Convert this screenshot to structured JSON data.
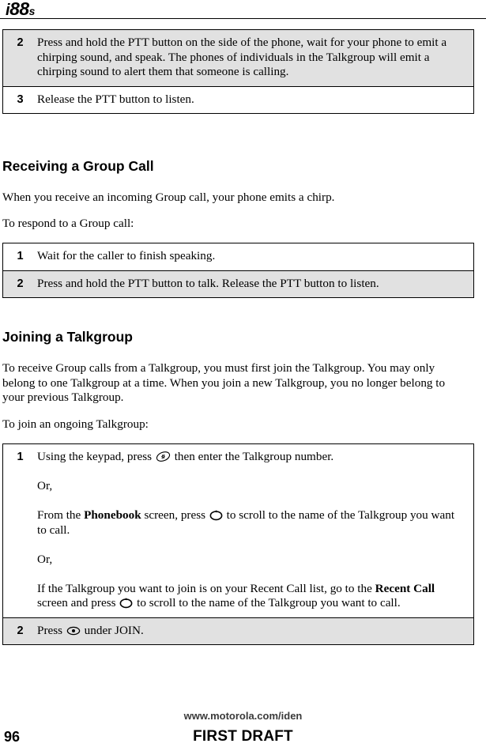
{
  "header": {
    "logo_i": "i",
    "logo_88": "88",
    "logo_s": "s"
  },
  "tables": {
    "making_group_call_continued": {
      "rows": [
        {
          "number": "2",
          "shaded": true,
          "text": "Press and hold the PTT button on the side of the phone, wait for your phone to emit a chirping sound, and speak. The phones of individuals in the Talkgroup will emit a chirping sound to alert them that someone is calling."
        },
        {
          "number": "3",
          "shaded": false,
          "text": "Release the PTT button to listen."
        }
      ]
    },
    "receiving_group_call": {
      "rows": [
        {
          "number": "1",
          "shaded": false,
          "text": "Wait for the caller to finish speaking."
        },
        {
          "number": "2",
          "shaded": true,
          "text": "Press and hold the PTT button to talk. Release the PTT button to listen."
        }
      ]
    },
    "joining_talkgroup": {
      "rows": [
        {
          "number": "1",
          "shaded": false,
          "paragraphs": {
            "p1_before_icon": "Using the keypad, press",
            "p1_icon": "pound-key-icon",
            "p1_after_icon": "then enter the Talkgroup number.",
            "p2": "Or,",
            "p3_a": "From the",
            "p3_bold": "Phonebook",
            "p3_b": "screen, press",
            "p3_icon": "navigation-key-icon",
            "p3_c": "to scroll to the name of the Talkgroup you want to call.",
            "p4": "Or,",
            "p5_a": "If the Talkgroup you want to join is on your Recent Call list, go to the",
            "p5_bold": "Recent Call",
            "p5_b": "screen and press",
            "p5_icon": "navigation-key-icon",
            "p5_c": "to scroll to the name of the Talkgroup you want to call."
          }
        },
        {
          "number": "2",
          "shaded": true,
          "paragraphs": {
            "p1_before_icon": "Press",
            "p1_icon": "menu-select-key-icon",
            "p1_after_icon": "under JOIN."
          }
        }
      ]
    }
  },
  "sections": {
    "receiving_heading": "Receiving a Group Call",
    "receiving_para_1": "When you receive an incoming Group call, your phone emits a chirp.",
    "receiving_para_2": "To respond to a Group call:",
    "joining_heading": "Joining a Talkgroup",
    "joining_para_1": "To receive Group calls from a Talkgroup, you must first join the Talkgroup. You may only belong to one Talkgroup at a time. When you join a new Talkgroup, you no longer belong to your previous Talkgroup.",
    "joining_para_2": "To join an ongoing Talkgroup:"
  },
  "footer": {
    "url": "www.motorola.com/iden",
    "page_number": "96",
    "draft_label": "FIRST DRAFT"
  },
  "colors": {
    "shaded_row": "#e1e1e1",
    "page_background": "#ffffff",
    "rule": "#000000",
    "footer_url": "#3a3a3a"
  }
}
